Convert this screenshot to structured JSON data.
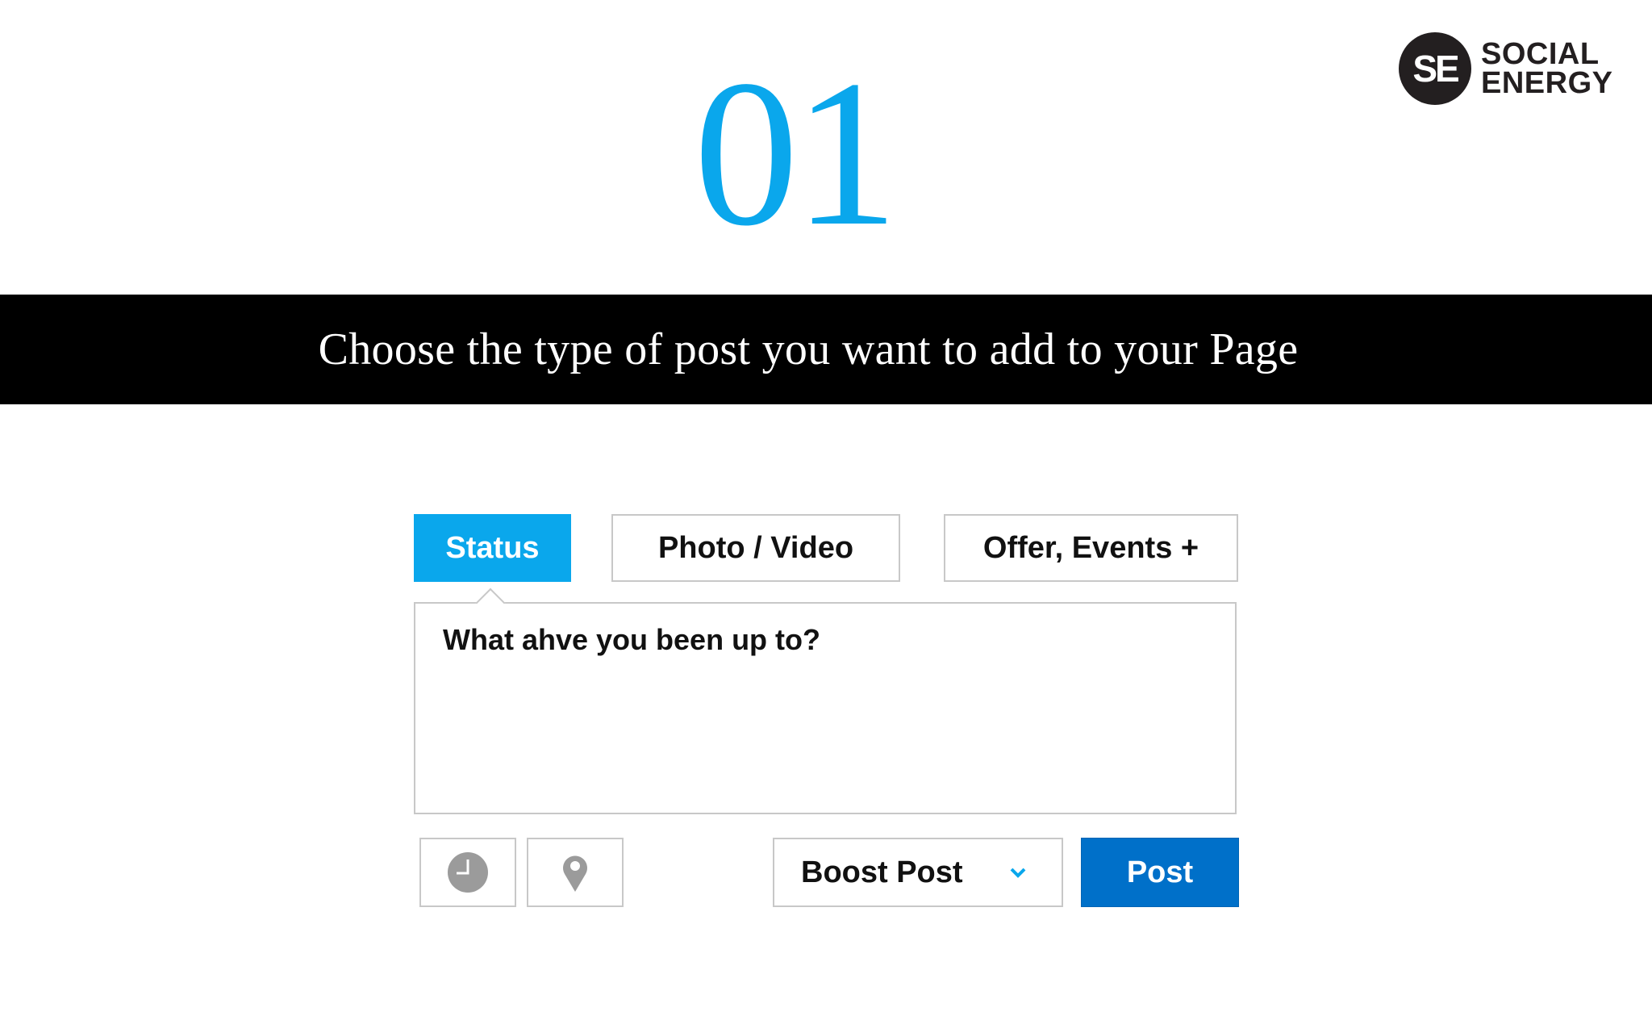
{
  "step": {
    "number": "01"
  },
  "brand": {
    "mark": "SE",
    "line1": "SOCIAL",
    "line2": "ENERGY"
  },
  "banner": {
    "text": "Choose the type of post you want to add to your Page"
  },
  "composer": {
    "tabs": [
      {
        "label": "Status",
        "active": true
      },
      {
        "label": "Photo / Video",
        "active": false
      },
      {
        "label": "Offer, Events +",
        "active": false
      }
    ],
    "textarea": {
      "placeholder": "What ahve you been up to?",
      "value": ""
    },
    "icons": {
      "schedule": "clock-icon",
      "location": "location-pin-icon",
      "boost_dropdown": "chevron-down-icon"
    },
    "boost_label": "Boost Post",
    "post_label": "Post"
  },
  "colors": {
    "accent": "#0aa7ec",
    "post_button": "#0070c9",
    "banner_bg": "#000000",
    "border": "#c8c8c8",
    "icon_gray": "#9b9b9b"
  }
}
